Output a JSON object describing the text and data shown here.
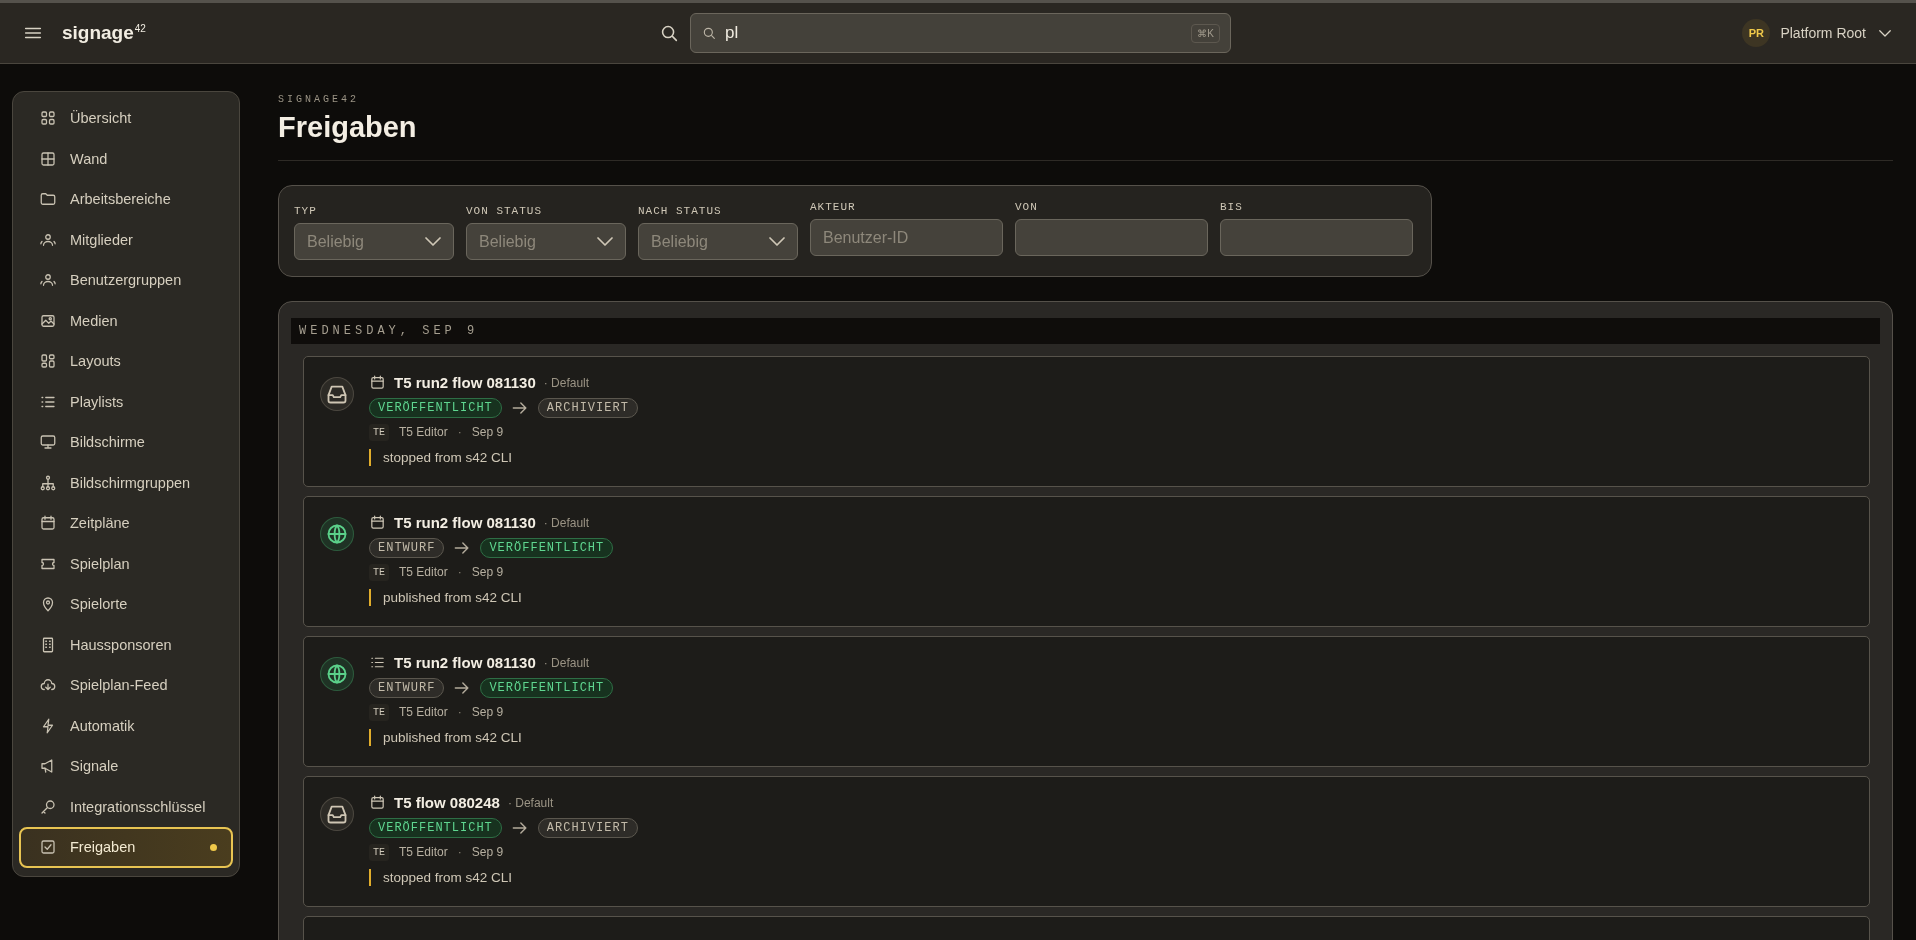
{
  "topbar": {
    "logo": "signage",
    "logo_sup": "42",
    "search": {
      "value": "pl",
      "shortcut": "⌘K"
    },
    "user": {
      "initials": "PR",
      "name": "Platform Root"
    }
  },
  "sidebar": {
    "items": [
      {
        "label": "Übersicht",
        "selected": false
      },
      {
        "label": "Wand",
        "selected": false
      },
      {
        "label": "Arbeitsbereiche",
        "selected": false
      },
      {
        "label": "Mitglieder",
        "selected": false
      },
      {
        "label": "Benutzergruppen",
        "selected": false
      },
      {
        "label": "Medien",
        "selected": false
      },
      {
        "label": "Layouts",
        "selected": false
      },
      {
        "label": "Playlists",
        "selected": false
      },
      {
        "label": "Bildschirme",
        "selected": false
      },
      {
        "label": "Bildschirmgruppen",
        "selected": false
      },
      {
        "label": "Zeitpläne",
        "selected": false
      },
      {
        "label": "Spielplan",
        "selected": false
      },
      {
        "label": "Spielorte",
        "selected": false
      },
      {
        "label": "Haussponsoren",
        "selected": false
      },
      {
        "label": "Spielplan-Feed",
        "selected": false
      },
      {
        "label": "Automatik",
        "selected": false
      },
      {
        "label": "Signale",
        "selected": false
      },
      {
        "label": "Integrationsschlüssel",
        "selected": false
      },
      {
        "label": "Freigaben",
        "selected": true
      }
    ]
  },
  "page": {
    "eyebrow": "SIGNAGE42",
    "title": "Freigaben"
  },
  "filters": [
    {
      "label": "TYP",
      "kind": "select",
      "placeholder": "Beliebig"
    },
    {
      "label": "VON STATUS",
      "kind": "select",
      "placeholder": "Beliebig"
    },
    {
      "label": "NACH STATUS",
      "kind": "select",
      "placeholder": "Beliebig"
    },
    {
      "label": "AKTEUR",
      "kind": "input",
      "placeholder": "Benutzer-ID"
    },
    {
      "label": "VON",
      "kind": "input"
    },
    {
      "label": "BIS",
      "kind": "input"
    }
  ],
  "timeline": {
    "date": "WEDNESDAY, SEP 9",
    "entries": [
      {
        "kind": "archive",
        "item": {
          "kind": "schedule",
          "title": "T5 run2 flow 081130"
        },
        "workspace": "· Default",
        "from": {
          "label": "VERÖFFENTLICHT",
          "kind": "published"
        },
        "to": {
          "label": "ARCHIVIERT",
          "kind": "neutral"
        },
        "actor_initials": "TE",
        "actor": "T5 Editor",
        "separator": "·",
        "date": "Sep 9",
        "note": "stopped from s42 CLI"
      },
      {
        "kind": "publish",
        "item": {
          "kind": "schedule",
          "title": "T5 run2 flow 081130"
        },
        "workspace": "· Default",
        "from": {
          "label": "ENTWURF",
          "kind": "neutral"
        },
        "to": {
          "label": "VERÖFFENTLICHT",
          "kind": "published"
        },
        "actor_initials": "TE",
        "actor": "T5 Editor",
        "separator": "·",
        "date": "Sep 9",
        "note": "published from s42 CLI"
      },
      {
        "kind": "publish",
        "item": {
          "kind": "playlist",
          "title": "T5 run2 flow 081130"
        },
        "workspace": "· Default",
        "from": {
          "label": "ENTWURF",
          "kind": "neutral"
        },
        "to": {
          "label": "VERÖFFENTLICHT",
          "kind": "published"
        },
        "actor_initials": "TE",
        "actor": "T5 Editor",
        "separator": "·",
        "date": "Sep 9",
        "note": "published from s42 CLI"
      },
      {
        "kind": "archive",
        "item": {
          "kind": "schedule",
          "title": "T5 flow 080248"
        },
        "workspace": "· Default",
        "from": {
          "label": "VERÖFFENTLICHT",
          "kind": "published"
        },
        "to": {
          "label": "ARCHIVIERT",
          "kind": "neutral"
        },
        "actor_initials": "TE",
        "actor": "T5 Editor",
        "separator": "·",
        "date": "Sep 9",
        "note": "stopped from s42 CLI"
      }
    ]
  }
}
